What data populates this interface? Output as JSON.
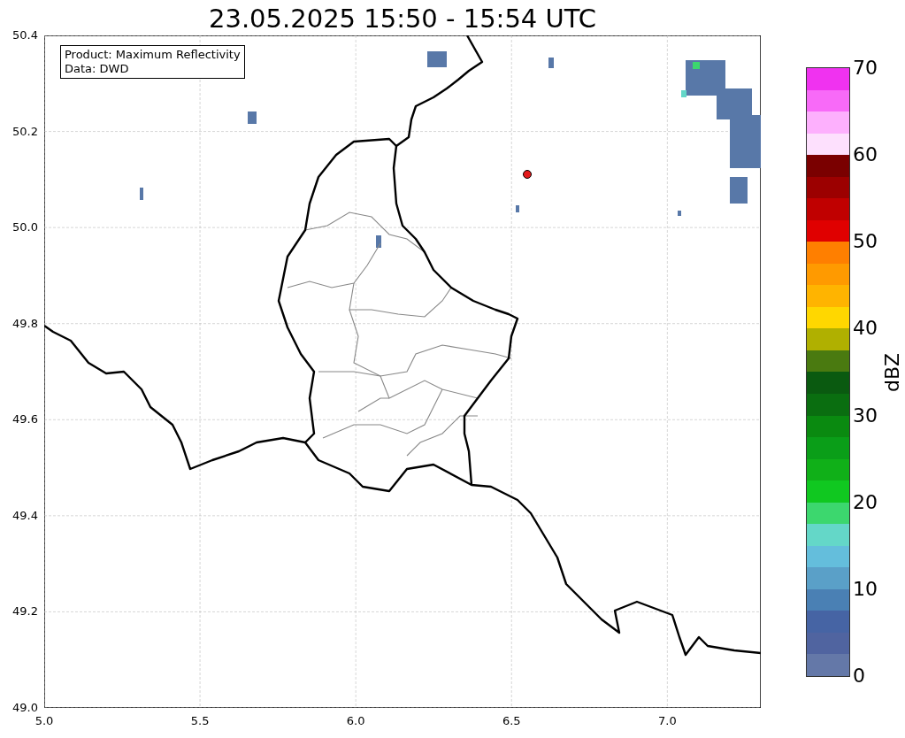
{
  "title": "23.05.2025 15:50 - 15:54 UTC",
  "legend": {
    "lines": [
      "Product: Maximum Reflectivity",
      "Data: DWD"
    ]
  },
  "map": {
    "xticks": [
      "5.0",
      "5.5",
      "6.0",
      "6.5",
      "7.0"
    ],
    "yticks": [
      "50.4",
      "50.2",
      "50.0",
      "49.8",
      "49.6",
      "49.4",
      "49.2",
      "49.0"
    ]
  },
  "colorbar": {
    "label": "dBZ",
    "ticks": [
      "70",
      "60",
      "50",
      "40",
      "30",
      "20",
      "10",
      "0"
    ],
    "bands": [
      {
        "color": "#f032f0"
      },
      {
        "color": "#f86af8"
      },
      {
        "color": "#fdb0fd"
      },
      {
        "color": "#fde0fd"
      },
      {
        "color": "#7a0000"
      },
      {
        "color": "#9c0000"
      },
      {
        "color": "#c00000"
      },
      {
        "color": "#e00000"
      },
      {
        "color": "#ff7f00"
      },
      {
        "color": "#ff9a00"
      },
      {
        "color": "#ffb400"
      },
      {
        "color": "#ffd700"
      },
      {
        "color": "#b0b000"
      },
      {
        "color": "#4a7a10"
      },
      {
        "color": "#0a5a10"
      },
      {
        "color": "#0a6e10"
      },
      {
        "color": "#0a8a10"
      },
      {
        "color": "#0a9e18"
      },
      {
        "color": "#10b018"
      },
      {
        "color": "#10c820"
      },
      {
        "color": "#3cd76e"
      },
      {
        "color": "#64d7c8"
      },
      {
        "color": "#64bedc"
      },
      {
        "color": "#5aa0c8"
      },
      {
        "color": "#4a80b4"
      },
      {
        "color": "#4664a4"
      },
      {
        "color": "#5064a0"
      },
      {
        "color": "#6478a8"
      }
    ]
  }
}
